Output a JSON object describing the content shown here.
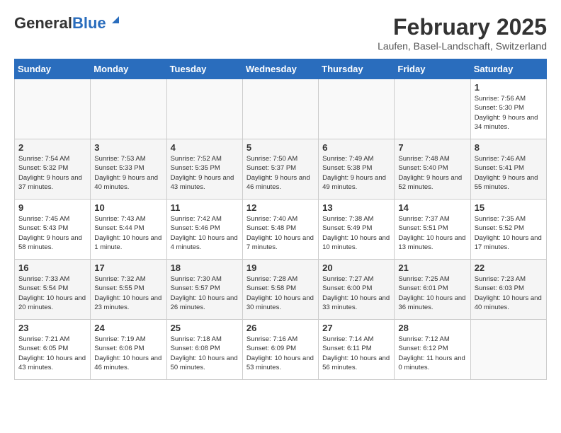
{
  "header": {
    "logo_line1": "General",
    "logo_line2": "Blue",
    "month_year": "February 2025",
    "location": "Laufen, Basel-Landschaft, Switzerland"
  },
  "weekdays": [
    "Sunday",
    "Monday",
    "Tuesday",
    "Wednesday",
    "Thursday",
    "Friday",
    "Saturday"
  ],
  "weeks": [
    [
      {
        "day": "",
        "info": ""
      },
      {
        "day": "",
        "info": ""
      },
      {
        "day": "",
        "info": ""
      },
      {
        "day": "",
        "info": ""
      },
      {
        "day": "",
        "info": ""
      },
      {
        "day": "",
        "info": ""
      },
      {
        "day": "1",
        "info": "Sunrise: 7:56 AM\nSunset: 5:30 PM\nDaylight: 9 hours and 34 minutes."
      }
    ],
    [
      {
        "day": "2",
        "info": "Sunrise: 7:54 AM\nSunset: 5:32 PM\nDaylight: 9 hours and 37 minutes."
      },
      {
        "day": "3",
        "info": "Sunrise: 7:53 AM\nSunset: 5:33 PM\nDaylight: 9 hours and 40 minutes."
      },
      {
        "day": "4",
        "info": "Sunrise: 7:52 AM\nSunset: 5:35 PM\nDaylight: 9 hours and 43 minutes."
      },
      {
        "day": "5",
        "info": "Sunrise: 7:50 AM\nSunset: 5:37 PM\nDaylight: 9 hours and 46 minutes."
      },
      {
        "day": "6",
        "info": "Sunrise: 7:49 AM\nSunset: 5:38 PM\nDaylight: 9 hours and 49 minutes."
      },
      {
        "day": "7",
        "info": "Sunrise: 7:48 AM\nSunset: 5:40 PM\nDaylight: 9 hours and 52 minutes."
      },
      {
        "day": "8",
        "info": "Sunrise: 7:46 AM\nSunset: 5:41 PM\nDaylight: 9 hours and 55 minutes."
      }
    ],
    [
      {
        "day": "9",
        "info": "Sunrise: 7:45 AM\nSunset: 5:43 PM\nDaylight: 9 hours and 58 minutes."
      },
      {
        "day": "10",
        "info": "Sunrise: 7:43 AM\nSunset: 5:44 PM\nDaylight: 10 hours and 1 minute."
      },
      {
        "day": "11",
        "info": "Sunrise: 7:42 AM\nSunset: 5:46 PM\nDaylight: 10 hours and 4 minutes."
      },
      {
        "day": "12",
        "info": "Sunrise: 7:40 AM\nSunset: 5:48 PM\nDaylight: 10 hours and 7 minutes."
      },
      {
        "day": "13",
        "info": "Sunrise: 7:38 AM\nSunset: 5:49 PM\nDaylight: 10 hours and 10 minutes."
      },
      {
        "day": "14",
        "info": "Sunrise: 7:37 AM\nSunset: 5:51 PM\nDaylight: 10 hours and 13 minutes."
      },
      {
        "day": "15",
        "info": "Sunrise: 7:35 AM\nSunset: 5:52 PM\nDaylight: 10 hours and 17 minutes."
      }
    ],
    [
      {
        "day": "16",
        "info": "Sunrise: 7:33 AM\nSunset: 5:54 PM\nDaylight: 10 hours and 20 minutes."
      },
      {
        "day": "17",
        "info": "Sunrise: 7:32 AM\nSunset: 5:55 PM\nDaylight: 10 hours and 23 minutes."
      },
      {
        "day": "18",
        "info": "Sunrise: 7:30 AM\nSunset: 5:57 PM\nDaylight: 10 hours and 26 minutes."
      },
      {
        "day": "19",
        "info": "Sunrise: 7:28 AM\nSunset: 5:58 PM\nDaylight: 10 hours and 30 minutes."
      },
      {
        "day": "20",
        "info": "Sunrise: 7:27 AM\nSunset: 6:00 PM\nDaylight: 10 hours and 33 minutes."
      },
      {
        "day": "21",
        "info": "Sunrise: 7:25 AM\nSunset: 6:01 PM\nDaylight: 10 hours and 36 minutes."
      },
      {
        "day": "22",
        "info": "Sunrise: 7:23 AM\nSunset: 6:03 PM\nDaylight: 10 hours and 40 minutes."
      }
    ],
    [
      {
        "day": "23",
        "info": "Sunrise: 7:21 AM\nSunset: 6:05 PM\nDaylight: 10 hours and 43 minutes."
      },
      {
        "day": "24",
        "info": "Sunrise: 7:19 AM\nSunset: 6:06 PM\nDaylight: 10 hours and 46 minutes."
      },
      {
        "day": "25",
        "info": "Sunrise: 7:18 AM\nSunset: 6:08 PM\nDaylight: 10 hours and 50 minutes."
      },
      {
        "day": "26",
        "info": "Sunrise: 7:16 AM\nSunset: 6:09 PM\nDaylight: 10 hours and 53 minutes."
      },
      {
        "day": "27",
        "info": "Sunrise: 7:14 AM\nSunset: 6:11 PM\nDaylight: 10 hours and 56 minutes."
      },
      {
        "day": "28",
        "info": "Sunrise: 7:12 AM\nSunset: 6:12 PM\nDaylight: 11 hours and 0 minutes."
      },
      {
        "day": "",
        "info": ""
      }
    ]
  ]
}
